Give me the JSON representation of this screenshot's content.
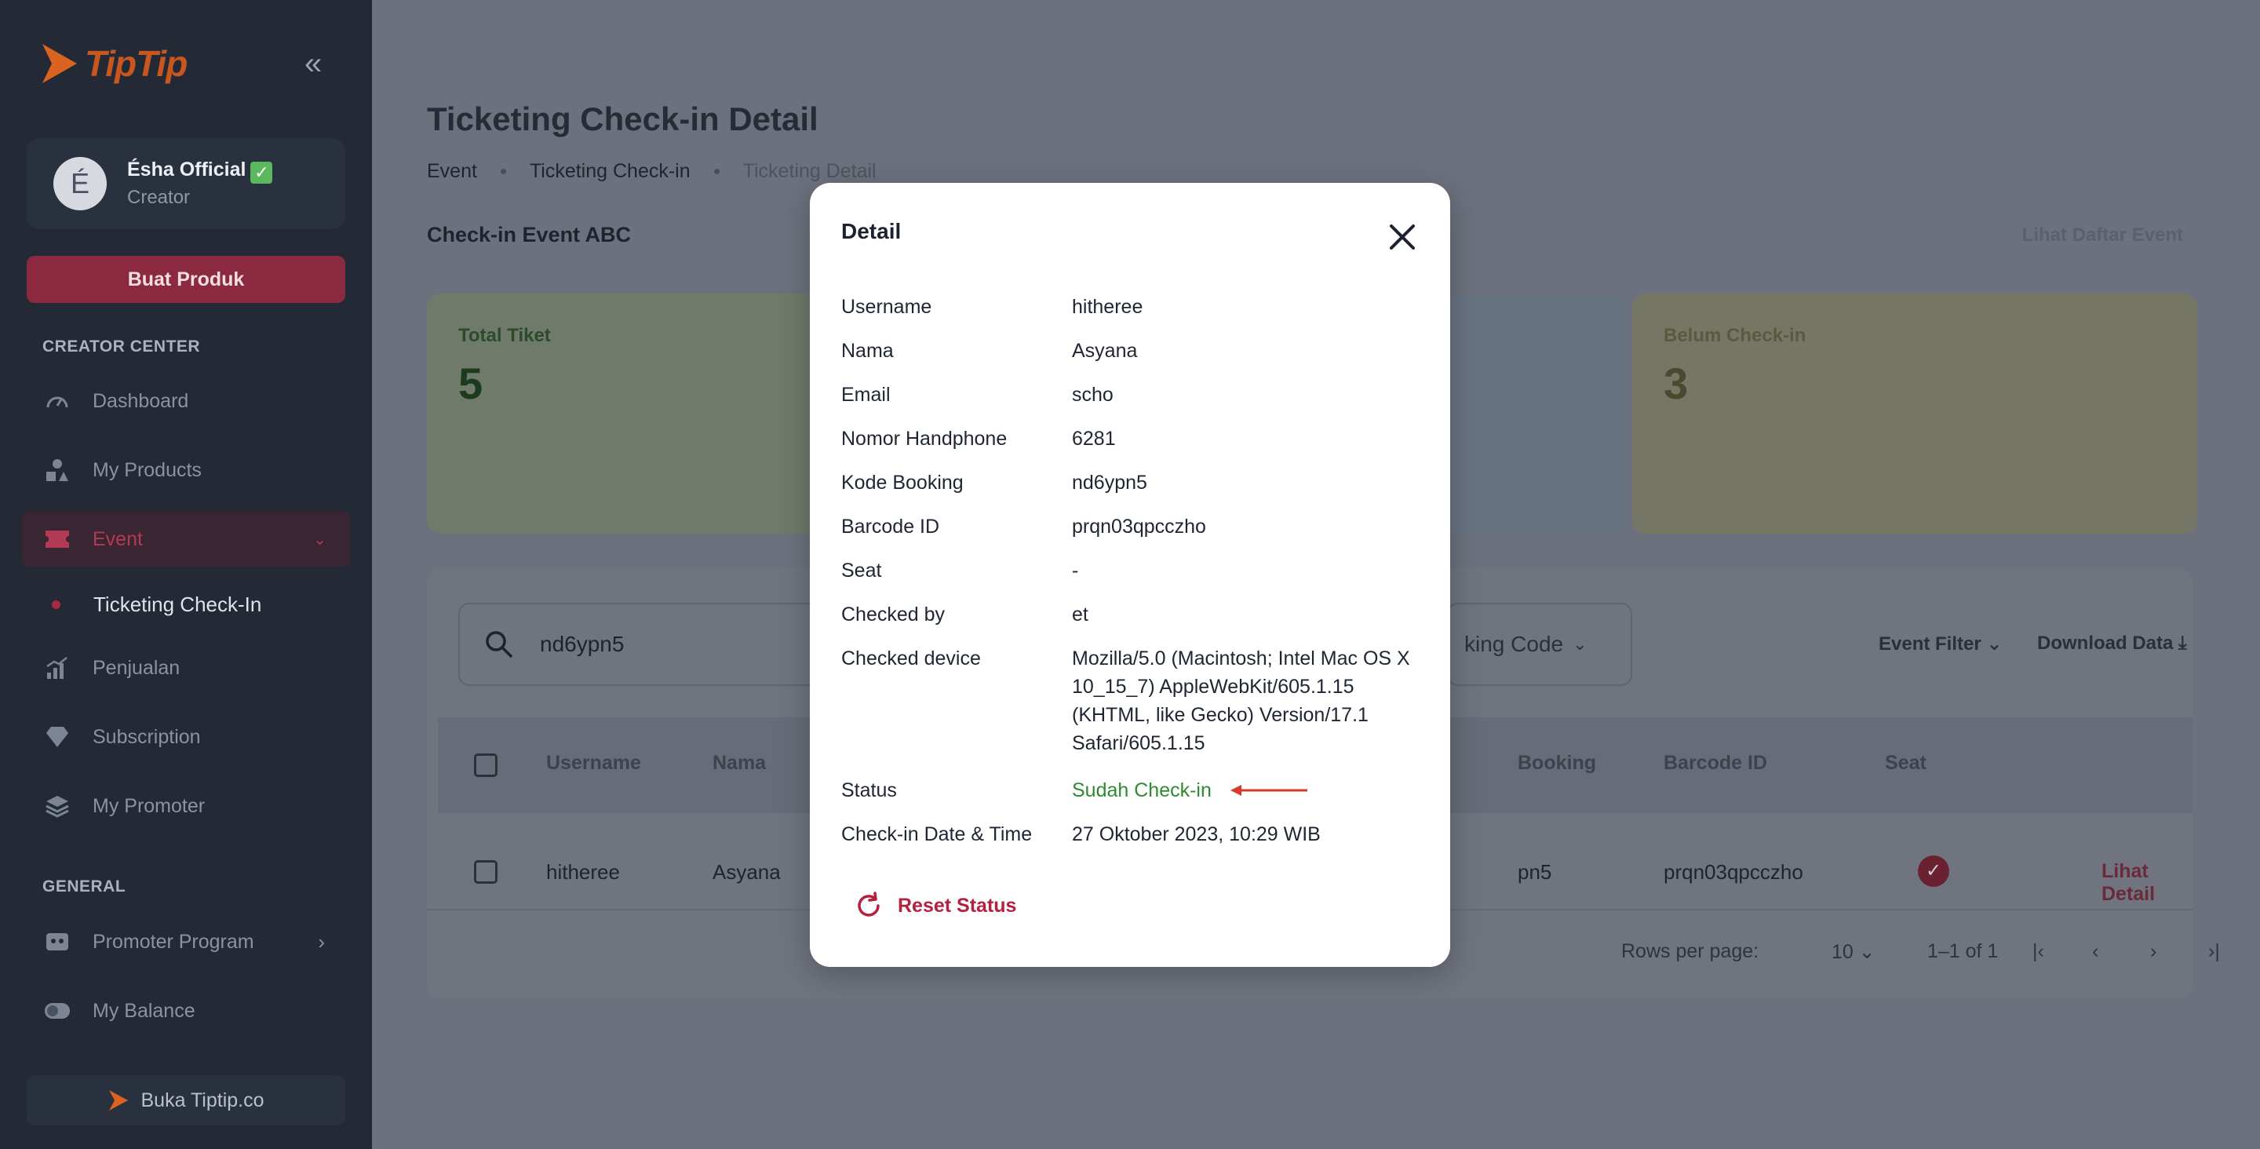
{
  "sidebar": {
    "brand": "TipTip",
    "profile": {
      "initial": "É",
      "name": "Ésha Official",
      "role": "Creator"
    },
    "create_button": "Buat Produk",
    "creator_center_label": "CREATOR CENTER",
    "items": [
      {
        "label": "Dashboard",
        "icon": "speedometer-icon"
      },
      {
        "label": "My Products",
        "icon": "shapes-icon"
      },
      {
        "label": "Event",
        "icon": "ticket-icon"
      },
      {
        "label": "Ticketing Check-In",
        "icon": "dot-icon"
      },
      {
        "label": "Penjualan",
        "icon": "bar-chart-icon"
      },
      {
        "label": "Subscription",
        "icon": "diamond-icon"
      },
      {
        "label": "My Promoter",
        "icon": "layers-icon"
      }
    ],
    "general_label": "GENERAL",
    "general_items": [
      {
        "label": "Promoter Program",
        "icon": "robot-icon"
      },
      {
        "label": "My Balance",
        "icon": "toggle-icon"
      }
    ],
    "footer_link": "Buka Tiptip.co",
    "colors": {
      "accent": "#8b2940",
      "background": "#232a36"
    }
  },
  "main": {
    "title": "Ticketing Check-in Detail",
    "breadcrumb": [
      "Event",
      "Ticketing Check-in",
      "Ticketing Detail"
    ],
    "event_name": "Check-in Event ABC",
    "lihat_daftar": "Lihat Daftar Event",
    "stats": [
      {
        "label": "Total Tiket",
        "value": "5"
      },
      {
        "label": "Belum Check-in",
        "value": "3"
      }
    ],
    "search": {
      "value": "nd6ypn5"
    },
    "booking_select": "king Code",
    "event_filter": "Event Filter",
    "download": "Download Data",
    "table": {
      "headers": [
        "Username",
        "Nama",
        "Booking",
        "Barcode ID",
        "Seat"
      ],
      "row": {
        "username": "hitheree",
        "nama": "Asyana",
        "booking": "pn5",
        "barcode": "prqn03qpcczho"
      },
      "action": "Lihat Detail"
    },
    "pagination": {
      "rows_label": "Rows per page:",
      "rows_value": "10",
      "range": "1–1 of 1"
    }
  },
  "modal": {
    "title": "Detail",
    "fields": [
      {
        "key": "Username",
        "value": "hitheree"
      },
      {
        "key": "Nama",
        "value": "Asyana"
      },
      {
        "key": "Email",
        "value": "scho"
      },
      {
        "key": "Nomor Handphone",
        "value": "6281"
      },
      {
        "key": "Kode Booking",
        "value": "nd6ypn5"
      },
      {
        "key": "Barcode ID",
        "value": "prqn03qpcczho"
      },
      {
        "key": "Seat",
        "value": "-"
      },
      {
        "key": "Checked by",
        "value": "et"
      },
      {
        "key": "Checked device",
        "value": "Mozilla/5.0 (Macintosh; Intel Mac OS X 10_15_7) AppleWebKit/605.1.15 (KHTML, like Gecko) Version/17.1 Safari/605.1.15"
      },
      {
        "key": "Status",
        "value": "Sudah Check-in"
      },
      {
        "key": "Check-in Date & Time",
        "value": "27 Oktober 2023, 10:29 WIB"
      }
    ],
    "reset_label": "Reset Status",
    "colors": {
      "status": "#2e8b2e",
      "reset": "#b4203f",
      "arrow": "#d63a2a"
    }
  }
}
